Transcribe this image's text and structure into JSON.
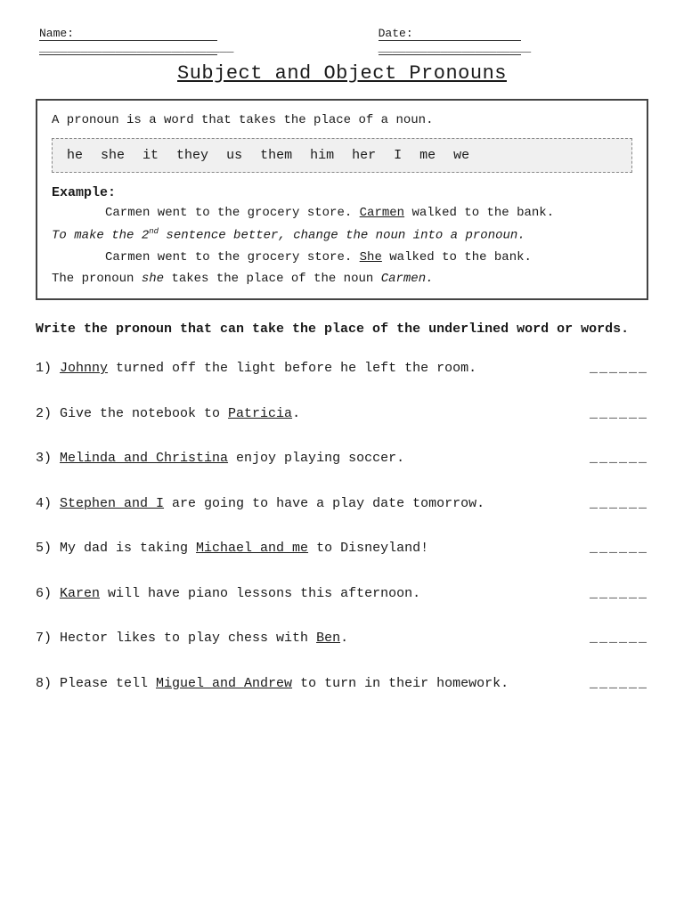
{
  "header": {
    "name_label": "Name:",
    "name_line": "____________________________",
    "date_label": "Date:",
    "date_line": "______________________"
  },
  "title": "Subject and Object Pronouns",
  "definition_box": {
    "definition": "A pronoun is a word that takes the place of a noun.",
    "pronouns": [
      "he",
      "she",
      "it",
      "they",
      "us",
      "them",
      "him",
      "her",
      "I",
      "me",
      "we"
    ],
    "example_label": "Example:",
    "example1": "Carmen went to the grocery store. Carmen walked to the bank.",
    "example1_underline": "Carmen",
    "italic_instruction": "To make the 2nd sentence better, change the noun into a pronoun.",
    "example2": "Carmen went to the grocery store. She walked to the bank.",
    "example2_underline": "She",
    "pronoun_note_prefix": "The pronoun ",
    "pronoun_note_italic1": "she",
    "pronoun_note_middle": " takes the place of the noun ",
    "pronoun_note_italic2": "Carmen",
    "pronoun_note_full": "The pronoun she takes the place of the noun Carmen."
  },
  "instructions": "Write the pronoun that can take the place of the underlined word or words.",
  "questions": [
    {
      "number": "1)",
      "text_before": " turned off the light before he left the room.",
      "underlined": "Johnny",
      "full_text": "Johnny turned off the light before he left the room.",
      "answer_line": "______"
    },
    {
      "number": "2)",
      "text_before": "Give the notebook to ",
      "underlined": "Patricia",
      "text_after": ".",
      "full_text": "Give the notebook to Patricia.",
      "answer_line": "______"
    },
    {
      "number": "3)",
      "text_before": " enjoy playing soccer.",
      "underlined": "Melinda and Christina",
      "full_text": "Melinda and Christina enjoy playing soccer.",
      "answer_line": "______"
    },
    {
      "number": "4)",
      "text_before": " are going to have a play date tomorrow.",
      "underlined": "Stephen and I",
      "full_text": "Stephen and I are going to have a play date tomorrow.",
      "answer_line": "______"
    },
    {
      "number": "5)",
      "text_before": "My dad is taking ",
      "underlined": "Michael and me",
      "text_after": " to Disneyland!",
      "full_text": "My dad is taking Michael and me to Disneyland!",
      "answer_line": "______"
    },
    {
      "number": "6)",
      "text_before": " will have piano lessons this afternoon.",
      "underlined": "Karen",
      "full_text": "Karen will have piano lessons this afternoon.",
      "answer_line": "______"
    },
    {
      "number": "7)",
      "text_before": "Hector likes to play chess with ",
      "underlined": "Ben",
      "text_after": ".",
      "full_text": "Hector likes to play chess with Ben.",
      "answer_line": "______"
    },
    {
      "number": "8)",
      "text_before": "Please tell ",
      "underlined": "Miguel and Andrew",
      "text_after": " to turn in their homework.",
      "full_text": "Please tell Miguel and Andrew to turn in their homework.",
      "answer_line": "______"
    }
  ]
}
